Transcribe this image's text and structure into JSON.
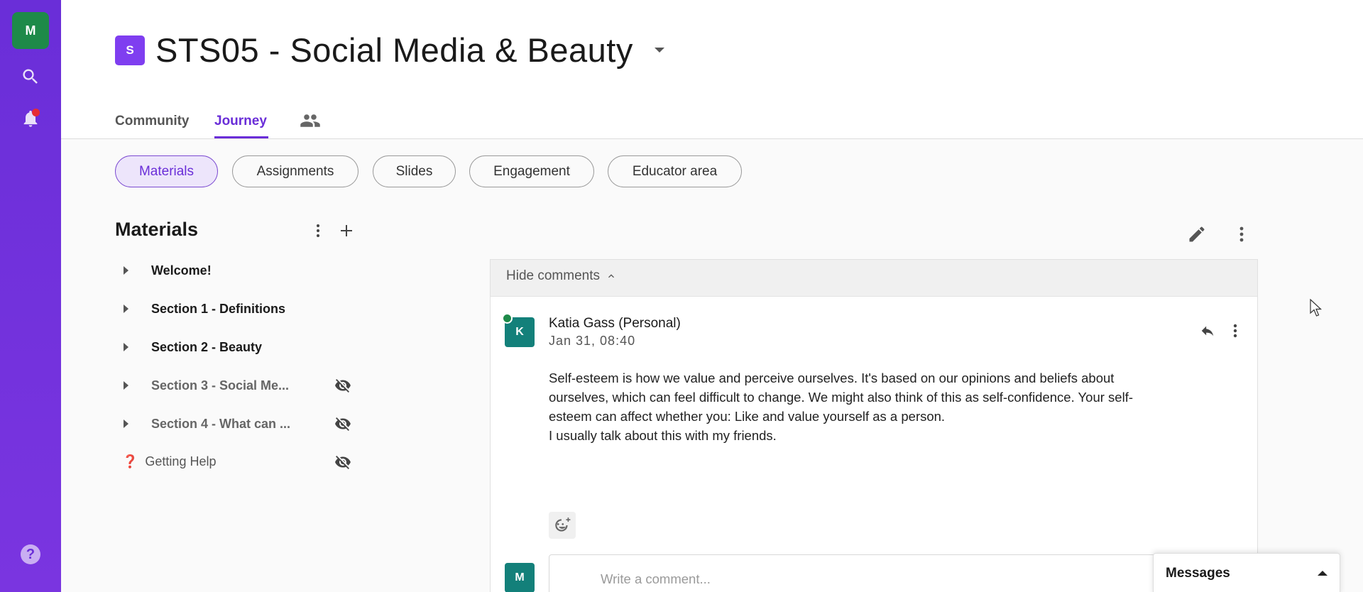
{
  "rail": {
    "user_initial": "M",
    "help_glyph": "?"
  },
  "course": {
    "badge": "S",
    "title": "STS05 - Social Media & Beauty"
  },
  "tabs": [
    {
      "label": "Community",
      "active": false
    },
    {
      "label": "Journey",
      "active": true
    }
  ],
  "pills": [
    {
      "label": "Materials",
      "active": true
    },
    {
      "label": "Assignments",
      "active": false
    },
    {
      "label": "Slides",
      "active": false
    },
    {
      "label": "Engagement",
      "active": false
    },
    {
      "label": "Educator area",
      "active": false
    }
  ],
  "materials": {
    "title": "Materials",
    "items": [
      {
        "label": "Welcome!",
        "hidden": false
      },
      {
        "label": "Section 1 - Definitions",
        "hidden": false
      },
      {
        "label": "Section 2 - Beauty",
        "hidden": false
      },
      {
        "label": "Section 3 - Social Me...",
        "hidden": true
      },
      {
        "label": "Section 4 - What can ...",
        "hidden": true
      }
    ],
    "help_item": {
      "icon": "❓",
      "label": "Getting Help",
      "hidden": true
    }
  },
  "comments": {
    "toggle_label": "Hide comments",
    "list": [
      {
        "author_initial": "K",
        "author": "Katia Gass (Personal)",
        "date": "Jan 31, 08:40",
        "online": true,
        "body_lines": [
          "Self-esteem is how we value and perceive ourselves. It's based on our opinions and beliefs about",
          "ourselves, which can feel difficult to change. We might also think of this as self-confidence. Your self-",
          "esteem can affect whether you: Like and value yourself as a person.",
          "I usually talk about this with my friends."
        ]
      }
    ],
    "composer": {
      "user_initial": "M",
      "placeholder": "Write a comment..."
    }
  },
  "messages": {
    "label": "Messages"
  },
  "colors": {
    "rail": "#6a2ed8",
    "accent": "#6a2ed8",
    "user_avatar": "#1e8a49",
    "comment_avatar": "#13807a",
    "badge": "#7f3ef0",
    "notification": "#e52d35"
  }
}
